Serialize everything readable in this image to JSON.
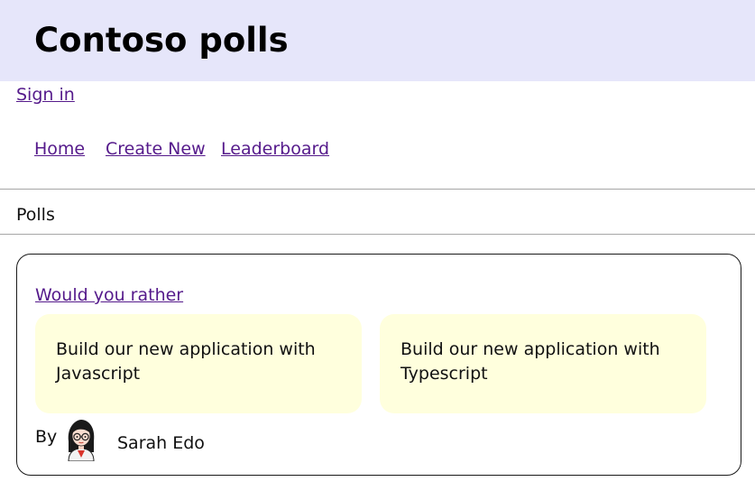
{
  "header": {
    "title": "Contoso polls"
  },
  "auth": {
    "sign_in": "Sign in"
  },
  "nav": {
    "items": [
      {
        "label": "Home"
      },
      {
        "label": "Create New"
      },
      {
        "label": "Leaderboard"
      }
    ]
  },
  "section": {
    "title": "Polls"
  },
  "poll": {
    "question": "Would you rather",
    "options": [
      {
        "text": "Build our new application with Javascript"
      },
      {
        "text": "Build our new application with Typescript"
      }
    ],
    "by_label": "By",
    "author": "Sarah Edo",
    "avatar_icon": "woman-with-glasses-avatar"
  },
  "colors": {
    "header_bg": "#e6e6fa",
    "option_bg": "#ffffdd",
    "link": "#551a8b"
  }
}
